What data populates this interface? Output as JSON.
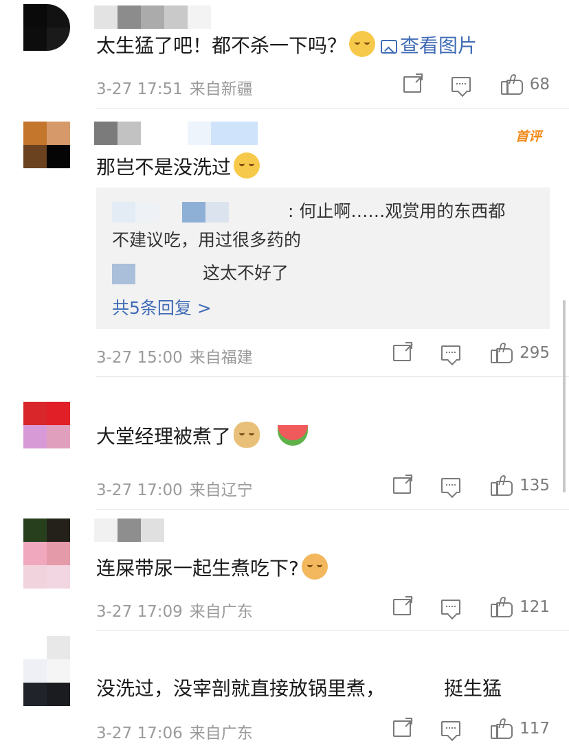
{
  "comments": [
    {
      "text": "太生猛了吧！都不杀一下吗？",
      "view_image": "查看图片",
      "time": "3-27 17:51",
      "region": "来自新疆",
      "likes": "68"
    },
    {
      "text": "那岂不是没洗过",
      "badge": "首评",
      "replies": [
        {
          "text": ": 何止啊……观赏用的东西都"
        },
        {
          "text": "不建议吃，用过很多药的"
        },
        {
          "text": "这太不好了"
        }
      ],
      "more_replies": "共5条回复 >",
      "time": "3-27 15:00",
      "region": "来自福建",
      "likes": "295"
    },
    {
      "text": "大堂经理被煮了",
      "time": "3-27 17:00",
      "region": "来自辽宁",
      "likes": "135"
    },
    {
      "text": "连屎带尿一起生煮吃下?",
      "time": "3-27 17:09",
      "region": "来自广东",
      "likes": "121"
    },
    {
      "text": "没洗过，没宰剖就直接放锅里煮，",
      "text_tail": "挺生猛",
      "time": "3-27 17:06",
      "region": "来自广东",
      "likes": "117"
    }
  ],
  "colors": {
    "link": "#3f6bb5",
    "badge": "#f28a1a",
    "meta": "#9a9a9a",
    "reply_bg": "#f2f2f2"
  },
  "icons": [
    "image-icon",
    "share-icon",
    "comment-icon",
    "like-icon"
  ]
}
